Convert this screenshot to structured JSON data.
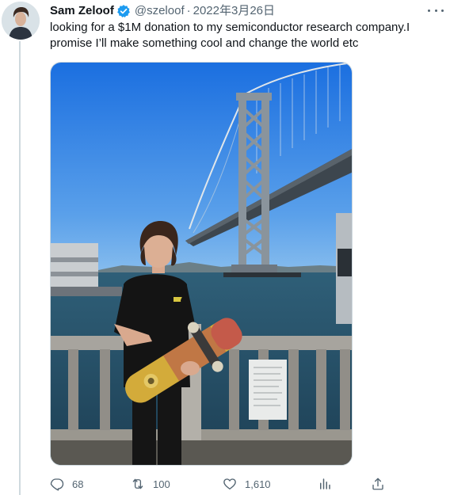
{
  "tweet": {
    "author_name": "Sam Zeloof",
    "handle": "@szeloof",
    "separator": "·",
    "date": "2022年3月26日",
    "text": "looking for a $1M donation to my semiconductor research company.I\npromise I’ll make something cool and change the world etc",
    "verified": true,
    "more_icon": "more-horizontal-icon",
    "colors": {
      "verified_badge": "#1d9bf0",
      "muted_text": "#536471",
      "primary_text": "#0f1419"
    }
  },
  "actions": {
    "replies": {
      "icon": "reply-icon",
      "count": "68"
    },
    "retweets": {
      "icon": "retweet-icon",
      "count": "100"
    },
    "likes": {
      "icon": "heart-icon",
      "count": "1,610"
    },
    "views": {
      "icon": "analytics-icon"
    },
    "share": {
      "icon": "share-icon"
    }
  }
}
